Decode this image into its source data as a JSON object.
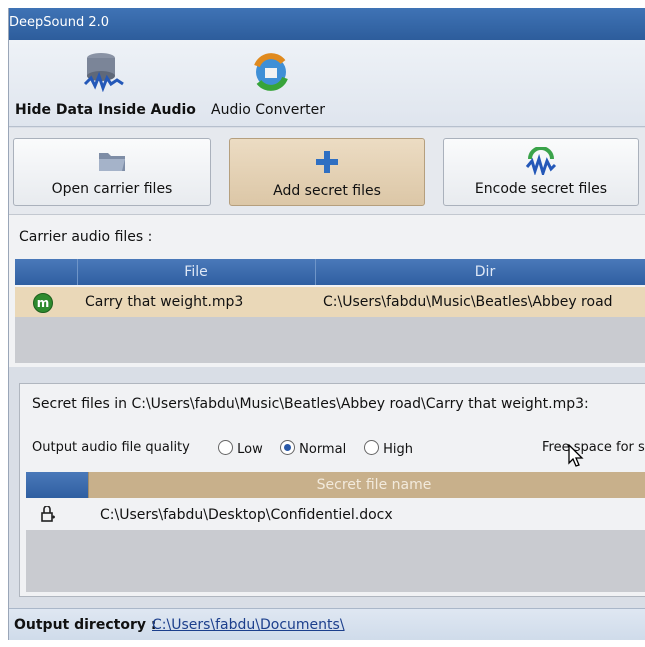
{
  "window": {
    "title": "DeepSound 2.0"
  },
  "ribbon": {
    "hide_label": "Hide Data Inside Audio",
    "converter_label": "Audio Converter"
  },
  "toolbar": {
    "open_label": "Open carrier files",
    "add_label": "Add secret files",
    "encode_label": "Encode secret files"
  },
  "carrier": {
    "section_label": "Carrier audio files :",
    "columns": [
      "File",
      "Dir"
    ],
    "rows": [
      {
        "badge": "m",
        "file": "Carry that weight.mp3",
        "dir": "C:\\Users\\fabdu\\Music\\Beatles\\Abbey road"
      }
    ]
  },
  "secret": {
    "title": "Secret files in C:\\Users\\fabdu\\Music\\Beatles\\Abbey road\\Carry that weight.mp3:",
    "quality_label": "Output audio file quality",
    "options": [
      "Low",
      "Normal",
      "High"
    ],
    "selected": "Normal",
    "free_space_label": "Free space for se",
    "column": "Secret file name",
    "rows": [
      {
        "path": "C:\\Users\\fabdu\\Desktop\\Confidentiel.docx"
      }
    ]
  },
  "footer": {
    "label": "Output directory :",
    "path": "C:\\Users\\fabdu\\Documents\\"
  },
  "colors": {
    "header_blue": "#2f5fa1",
    "selected_row": "#ead8b8",
    "active_button": "#dcc7a7"
  },
  "icons": [
    "audio-stack-icon",
    "converter-icon",
    "folder-icon",
    "plus-icon",
    "encode-icon",
    "m-badge-icon",
    "attach-icon",
    "cursor-icon"
  ]
}
